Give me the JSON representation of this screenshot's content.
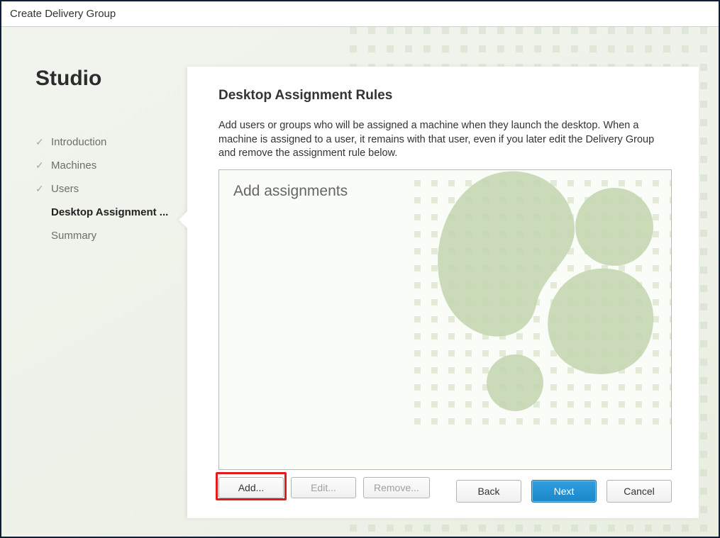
{
  "window": {
    "title": "Create Delivery Group"
  },
  "brand": "Studio",
  "steps": {
    "items": [
      {
        "label": "Introduction",
        "state": "done"
      },
      {
        "label": "Machines",
        "state": "done"
      },
      {
        "label": "Users",
        "state": "done"
      },
      {
        "label": "Desktop Assignment ...",
        "state": "current"
      },
      {
        "label": "Summary",
        "state": "future"
      }
    ]
  },
  "page": {
    "title": "Desktop Assignment Rules",
    "description": "Add users or groups who will be assigned a machine when they launch the desktop. When a machine is assigned to a user, it remains with that user, even if you later edit the Delivery Group and remove the assignment rule below.",
    "list_placeholder": "Add assignments"
  },
  "list_buttons": {
    "add": "Add...",
    "edit": "Edit...",
    "remove": "Remove..."
  },
  "wizard_buttons": {
    "back": "Back",
    "next": "Next",
    "cancel": "Cancel"
  },
  "colors": {
    "primary": "#1d86c9",
    "highlight": "#e21a1a"
  }
}
